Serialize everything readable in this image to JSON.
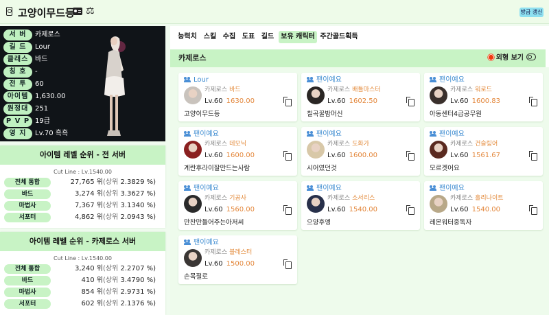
{
  "header": {
    "title": "고양이무드등",
    "refresh_label": "방금 갱신"
  },
  "profile": {
    "rows": [
      {
        "label": "서 버",
        "value": "카제로스"
      },
      {
        "label": "길 드",
        "value": "Lour"
      },
      {
        "label": "클래스",
        "value": "바드"
      },
      {
        "label": "칭 호",
        "value": "-"
      },
      {
        "label": "전 투",
        "value": "60"
      },
      {
        "label": "아이템",
        "value": "1,630.00"
      },
      {
        "label": "원정대",
        "value": "251"
      },
      {
        "label": "P V P",
        "value": "19급"
      },
      {
        "label": "영 지",
        "value": "Lv.70 흑흑"
      }
    ]
  },
  "rank_all": {
    "title": "아이템 레벨 순위 - 전 서버",
    "cut": "Cut Line : Lv.1540.00",
    "rows": [
      {
        "key": "전체 통합",
        "rank": "27,765 위",
        "pct_label": "(상위",
        "pct": "2.3829 %)"
      },
      {
        "key": "바드",
        "rank": "3,274 위",
        "pct_label": "(상위",
        "pct": "3.3627 %)"
      },
      {
        "key": "마법사",
        "rank": "7,367 위",
        "pct_label": "(상위",
        "pct": "3.1340 %)"
      },
      {
        "key": "서포터",
        "rank": "4,862 위",
        "pct_label": "(상위",
        "pct": "2.0943 %)"
      }
    ]
  },
  "rank_server": {
    "title": "아이템 레벨 순위 - 카제로스 서버",
    "cut": "Cut Line : Lv.1540.00",
    "rows": [
      {
        "key": "전체 통합",
        "rank": "3,240 위",
        "pct_label": "(상위",
        "pct": "2.2707 %)"
      },
      {
        "key": "바드",
        "rank": "410 위",
        "pct_label": "(상위",
        "pct": "3.4790 %)"
      },
      {
        "key": "마법사",
        "rank": "854 위",
        "pct_label": "(상위",
        "pct": "2.9731 %)"
      },
      {
        "key": "서포터",
        "rank": "602 위",
        "pct_label": "(상위",
        "pct": "2.1376 %)"
      }
    ]
  },
  "tabs": [
    "능력치",
    "스킬",
    "수집",
    "도표",
    "길드",
    "보유 캐릭터",
    "주간골드획득"
  ],
  "roster": {
    "server": "카제로스",
    "look_label": "외형 보기",
    "characters": [
      {
        "guild": "Lour",
        "server": "카제로스",
        "class": "바드",
        "level": "Lv.60",
        "ilvl": "1630.00",
        "name": "고양이무드등",
        "avatar_color": "#c9c3bd"
      },
      {
        "guild": "팬이예요",
        "server": "카제로스",
        "class": "배틀마스터",
        "level": "Lv.60",
        "ilvl": "1602.50",
        "name": "칠곡꿀밤머신",
        "avatar_color": "#2a2624"
      },
      {
        "guild": "팬이예요",
        "server": "카제로스",
        "class": "워로드",
        "level": "Lv.60",
        "ilvl": "1600.83",
        "name": "아동센터4급공무원",
        "avatar_color": "#3a302c"
      },
      {
        "guild": "팬이예요",
        "server": "카제로스",
        "class": "데모닉",
        "level": "Lv.60",
        "ilvl": "1600.00",
        "name": "계란후라이잘만드는사람",
        "avatar_color": "#8a2020"
      },
      {
        "guild": "팬이예요",
        "server": "카제로스",
        "class": "도화가",
        "level": "Lv.60",
        "ilvl": "1600.00",
        "name": "시어였던것",
        "avatar_color": "#d8c8a8"
      },
      {
        "guild": "팬이예요",
        "server": "카제로스",
        "class": "건슬링어",
        "level": "Lv.60",
        "ilvl": "1561.67",
        "name": "모르겟어요",
        "avatar_color": "#5a2a20"
      },
      {
        "guild": "팬이예요",
        "server": "카제로스",
        "class": "기공사",
        "level": "Lv.60",
        "ilvl": "1560.00",
        "name": "만찬만들어주는아저씨",
        "avatar_color": "#2a2a2a"
      },
      {
        "guild": "팬이예요",
        "server": "카제로스",
        "class": "소서리스",
        "level": "Lv.60",
        "ilvl": "1540.00",
        "name": "으양후엥",
        "avatar_color": "#28304a"
      },
      {
        "guild": "팬이예요",
        "server": "카제로스",
        "class": "홀리나이트",
        "level": "Lv.60",
        "ilvl": "1540.00",
        "name": "레몬워터중독자",
        "avatar_color": "#b8a888"
      },
      {
        "guild": "팬이예요",
        "server": "카제로스",
        "class": "블레스터",
        "level": "Lv.60",
        "ilvl": "1500.00",
        "name": "손목절로",
        "avatar_color": "#3a3634"
      }
    ]
  }
}
